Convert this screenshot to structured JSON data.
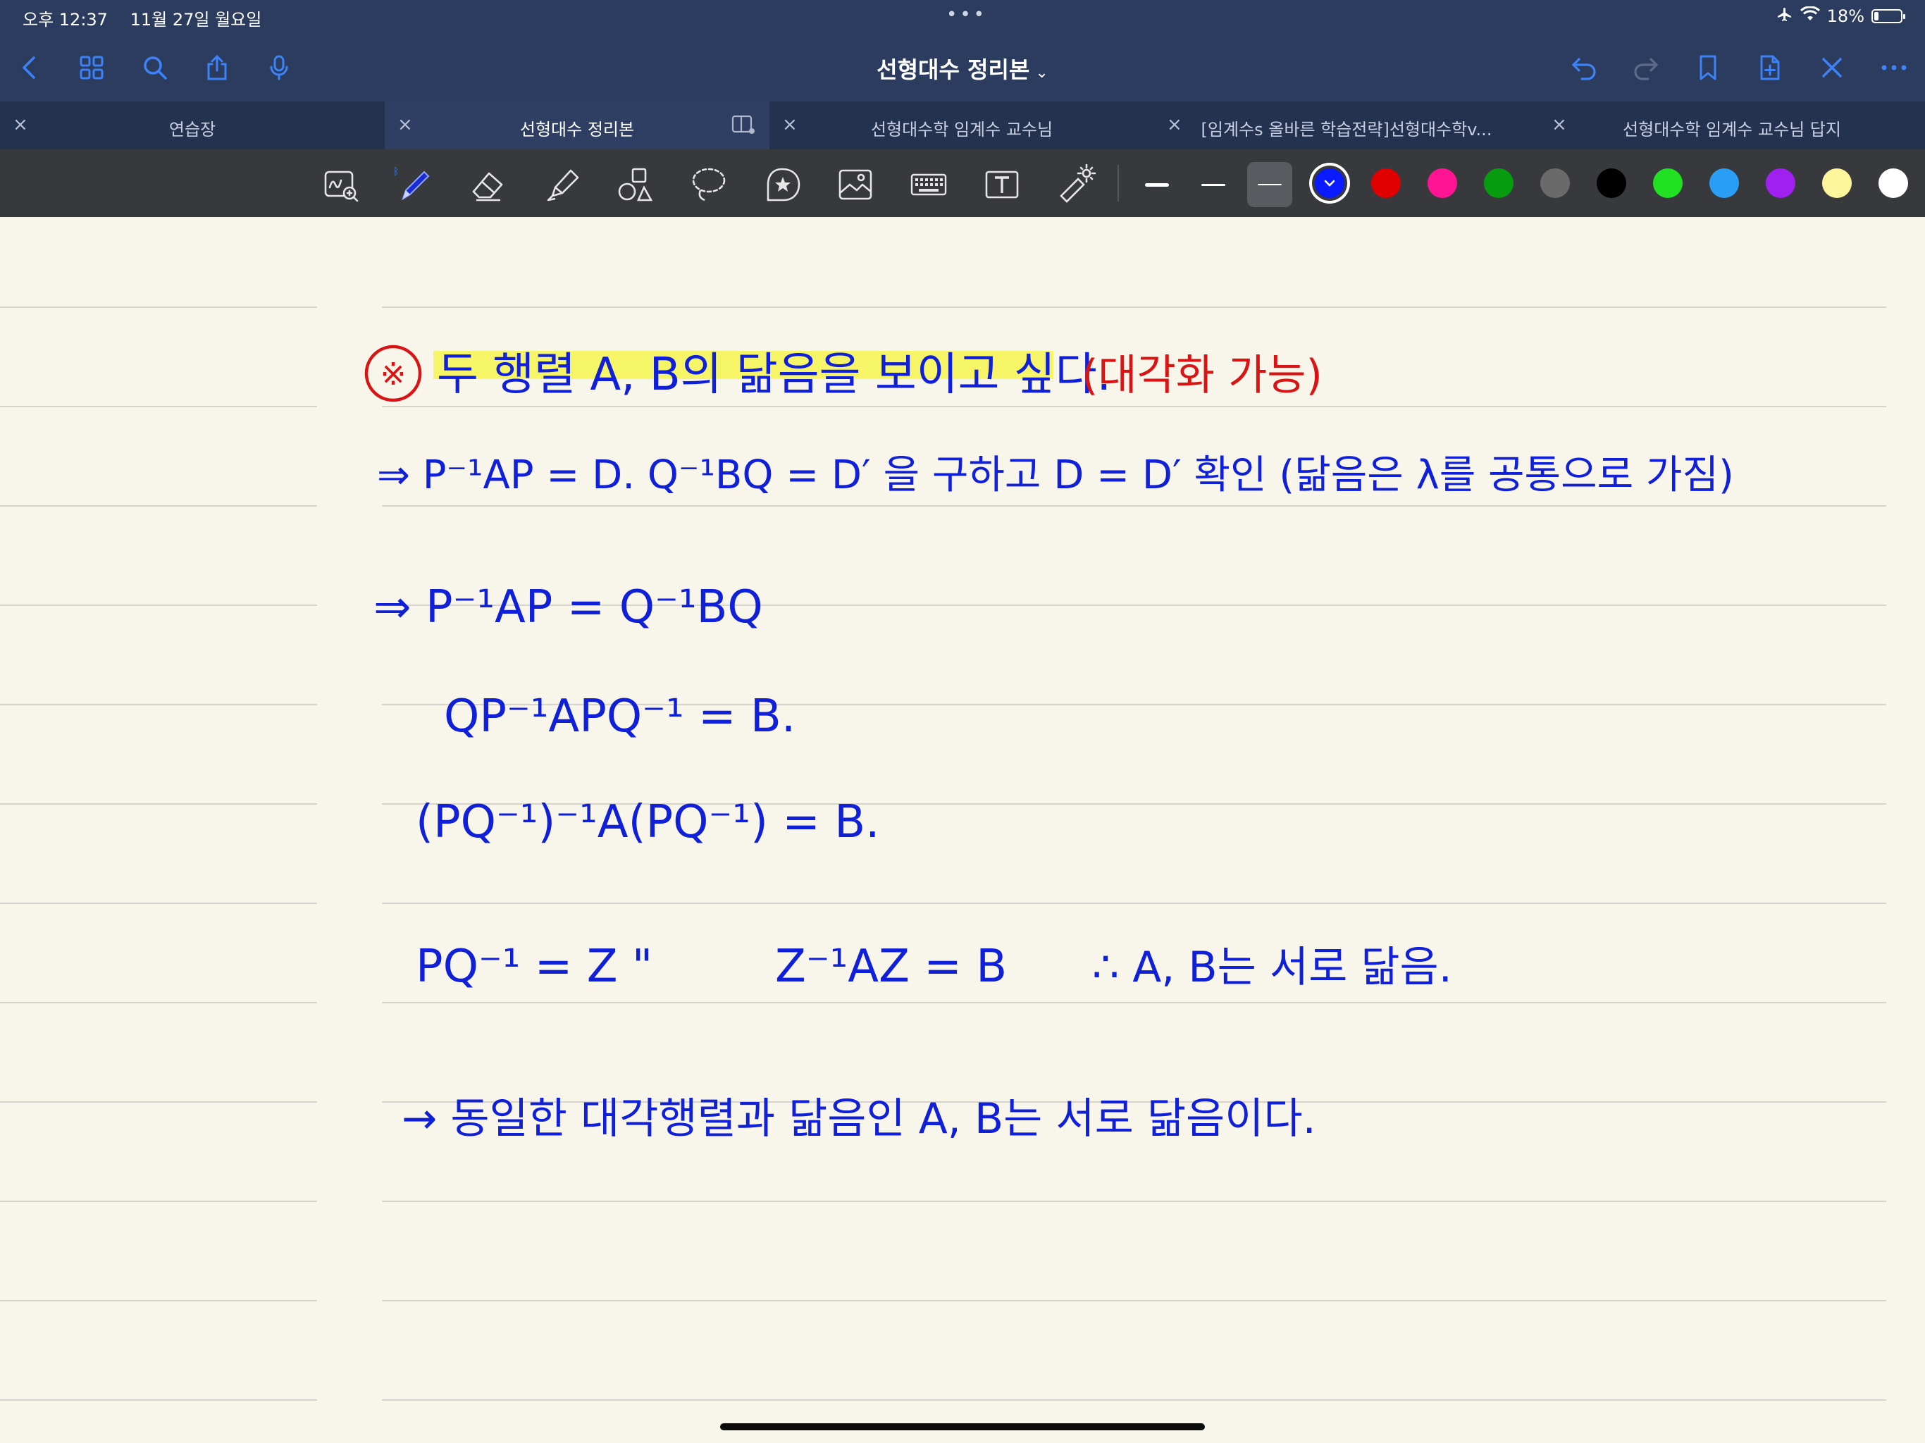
{
  "status": {
    "time": "오후 12:37",
    "date": "11월 27일 월요일",
    "battery_pct": "18%",
    "battery_level": 0.18,
    "icons": [
      "airplane-icon",
      "wifi-icon",
      "battery-icon"
    ]
  },
  "nav": {
    "title": "선형대수 정리본",
    "left_icons": [
      "back-icon",
      "grid-icon",
      "search-icon",
      "share-icon",
      "microphone-icon"
    ],
    "right_icons": [
      "undo-icon",
      "redo-icon",
      "bookmark-icon",
      "add-page-icon",
      "close-icon",
      "more-icon"
    ]
  },
  "tabs": [
    {
      "label": "연습장",
      "active": false
    },
    {
      "label": "선형대수 정리본",
      "active": true
    },
    {
      "label": "선형대수학 임계수 교수님",
      "active": false
    },
    {
      "label": "[임계수s 올바른 학습전략]선형대수학v...",
      "active": false
    },
    {
      "label": "선형대수학 임계수 교수님 답지",
      "active": false
    }
  ],
  "tools": [
    "zoom-window-icon",
    "pen-icon",
    "eraser-icon",
    "highlighter-icon",
    "shapes-icon",
    "lasso-icon",
    "sticker-icon",
    "image-icon",
    "keyboard-icon",
    "text-box-icon",
    "laser-pointer-icon"
  ],
  "selected_tool": "pen-icon",
  "colors": {
    "accent": "#3d82f6",
    "swatches": [
      "#0a1aff",
      "#e00000",
      "#ff1493",
      "#079b0f",
      "#6a6a6a",
      "#000000",
      "#22e022",
      "#2a9df4",
      "#a020f0",
      "#fff59d",
      "#ffffff"
    ],
    "selected_swatch": "#0a1aff",
    "ink_blue": "#1020d8",
    "ink_red": "#d81414",
    "highlight": "#f5f55a"
  },
  "note": {
    "line1_mark": "※",
    "line1_text": "두 행렬 A, B의 닮음을 보이고 싶다.",
    "line1_paren": "(대각화 가능)",
    "line2": "⇒ P⁻¹AP = D.   Q⁻¹BQ = D′ 을 구하고   D = D′ 확인 (닮음은 λ를 공통으로 가짐)",
    "line3": "⇒ P⁻¹AP = Q⁻¹BQ",
    "line4": "QP⁻¹APQ⁻¹ = B.",
    "line5": "(PQ⁻¹)⁻¹A(PQ⁻¹) = B.",
    "line6a": "PQ⁻¹ = Z \"",
    "line6b": "Z⁻¹AZ = B",
    "line6c": "∴ A, B는 서로 닮음.",
    "line7": "→ 동일한 대각행렬과 닮음인 A, B는 서로 닮음이다."
  }
}
